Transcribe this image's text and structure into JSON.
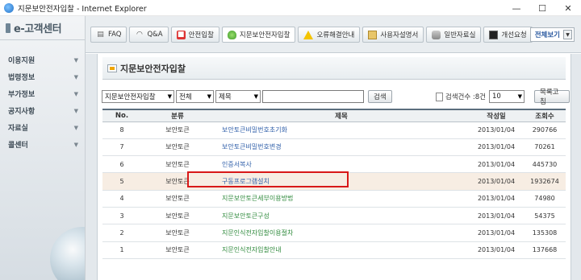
{
  "window": {
    "title": "지문보안전자입찰 - Internet Explorer",
    "min": "—",
    "max": "☐",
    "close": "✕"
  },
  "sidebar": {
    "brand": "e-고객센터",
    "items": [
      {
        "label": "이용지원"
      },
      {
        "label": "법령정보"
      },
      {
        "label": "부가정보"
      },
      {
        "label": "공지사항"
      },
      {
        "label": "자료실"
      },
      {
        "label": "콜센터"
      }
    ]
  },
  "tabs": [
    {
      "label": "FAQ",
      "icon": "faq-icon"
    },
    {
      "label": "Q&A",
      "icon": "headset-icon"
    },
    {
      "label": "안전입찰",
      "icon": "security-icon"
    },
    {
      "label": "지문보안전자입찰",
      "icon": "shield-icon"
    },
    {
      "label": "오류해결안내",
      "icon": "warning-icon"
    },
    {
      "label": "사용자설명서",
      "icon": "manual-icon"
    },
    {
      "label": "일반자료실",
      "icon": "database-icon"
    },
    {
      "label": "개선요청",
      "icon": "request-icon"
    }
  ],
  "view_all": "전체보기",
  "page_title": "지문보안전자입찰",
  "search": {
    "category": "지문보안전자입찰",
    "scope": "전체",
    "field": "제목",
    "keyword": "",
    "search_button": "검색",
    "count_label": "검색건수 :8건",
    "rows_per_page": "10",
    "reset_button": "목록고침"
  },
  "table": {
    "columns": [
      "No.",
      "분류",
      "제목",
      "작성일",
      "조회수"
    ],
    "rows": [
      {
        "no": "8",
        "category": "보안토큰",
        "title": "보안토큰비밀번호초기화",
        "date": "2013/01/04",
        "views": "290766"
      },
      {
        "no": "7",
        "category": "보안토큰",
        "title": "보안토큰비밀번호변경",
        "date": "2013/01/04",
        "views": "70261"
      },
      {
        "no": "6",
        "category": "보안토큰",
        "title": "인증서복사",
        "date": "2013/01/04",
        "views": "445730"
      },
      {
        "no": "5",
        "category": "보안토큰",
        "title": "구동프로그램설치",
        "date": "2013/01/04",
        "views": "1932674"
      },
      {
        "no": "4",
        "category": "보안토큰",
        "title": "지문보안토큰세부이용방법",
        "date": "2013/01/04",
        "views": "74980"
      },
      {
        "no": "3",
        "category": "보안토큰",
        "title": "지문보안토큰구성",
        "date": "2013/01/04",
        "views": "54375"
      },
      {
        "no": "2",
        "category": "보안토큰",
        "title": "지문인식전자입찰이용절차",
        "date": "2013/01/04",
        "views": "135308"
      },
      {
        "no": "1",
        "category": "보안토큰",
        "title": "지문인식전자입찰안내",
        "date": "2013/01/04",
        "views": "137668"
      }
    ]
  },
  "colors": {
    "link_blue": "#2d5da8",
    "link_green": "#2f8a3c",
    "highlight_row": "#f7ede3",
    "annotation_red": "#d81818"
  }
}
